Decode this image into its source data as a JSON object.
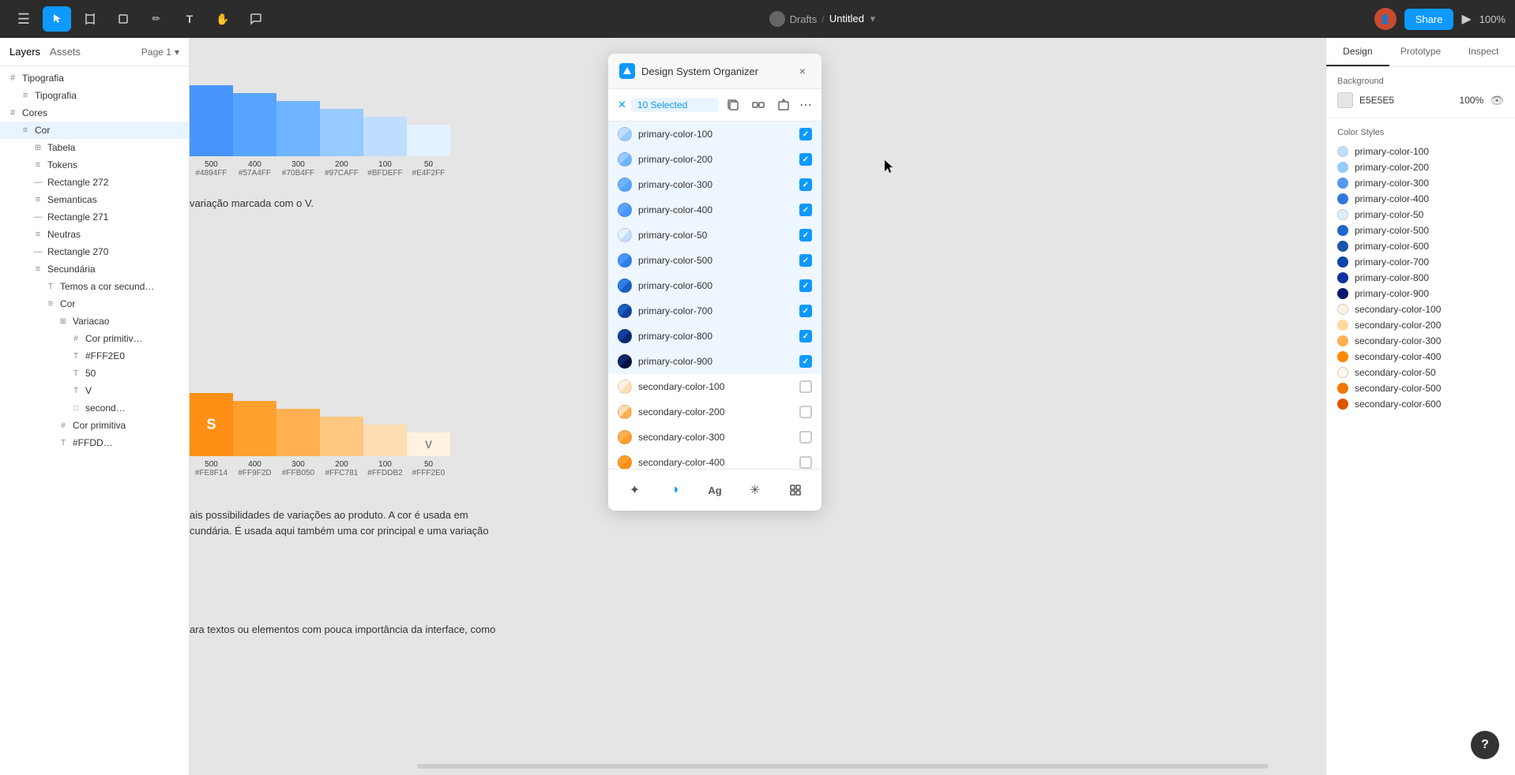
{
  "topbar": {
    "drafts_label": "Drafts",
    "separator": "/",
    "file_name": "Untitled",
    "share_label": "Share",
    "zoom_level": "100%",
    "tools": [
      {
        "name": "menu",
        "icon": "☰",
        "active": false
      },
      {
        "name": "move",
        "icon": "↖",
        "active": true
      },
      {
        "name": "frame",
        "icon": "⊞",
        "active": false
      },
      {
        "name": "shape",
        "icon": "□",
        "active": false
      },
      {
        "name": "pen",
        "icon": "✏",
        "active": false
      },
      {
        "name": "text",
        "icon": "T",
        "active": false
      },
      {
        "name": "hand",
        "icon": "✋",
        "active": false
      },
      {
        "name": "comment",
        "icon": "💬",
        "active": false
      }
    ]
  },
  "left_panel": {
    "tabs": [
      {
        "label": "Layers",
        "active": true
      },
      {
        "label": "Assets",
        "active": false
      }
    ],
    "page_selector": "Page 1",
    "layers": [
      {
        "id": "tipografia-group",
        "indent": 0,
        "icon": "#",
        "label": "Tipografia",
        "type": "group"
      },
      {
        "id": "tipografia-item",
        "indent": 1,
        "icon": "≡",
        "label": "Tipografia",
        "type": "item"
      },
      {
        "id": "cores-group",
        "indent": 0,
        "icon": "#",
        "label": "Cores",
        "type": "group"
      },
      {
        "id": "cor-item",
        "indent": 1,
        "icon": "≡",
        "label": "Cor",
        "type": "item",
        "selected": true
      },
      {
        "id": "tabela-item",
        "indent": 2,
        "icon": "⊞",
        "label": "Tabela",
        "type": "item"
      },
      {
        "id": "tokens-item",
        "indent": 2,
        "icon": "≡",
        "label": "Tokens",
        "type": "item"
      },
      {
        "id": "rect272-item",
        "indent": 2,
        "icon": "—",
        "label": "Rectangle 272",
        "type": "item"
      },
      {
        "id": "semanticas-item",
        "indent": 2,
        "icon": "≡",
        "label": "Semanticas",
        "type": "item"
      },
      {
        "id": "rect271-item",
        "indent": 2,
        "icon": "—",
        "label": "Rectangle 271",
        "type": "item"
      },
      {
        "id": "neutras-item",
        "indent": 2,
        "icon": "≡",
        "label": "Neutras",
        "type": "item"
      },
      {
        "id": "rect270-item",
        "indent": 2,
        "icon": "—",
        "label": "Rectangle 270",
        "type": "item"
      },
      {
        "id": "secundaria-item",
        "indent": 2,
        "icon": "≡",
        "label": "Secundária",
        "type": "item"
      },
      {
        "id": "temos-cor",
        "indent": 3,
        "icon": "T",
        "label": "Temos a cor secund…",
        "type": "item"
      },
      {
        "id": "cor2-item",
        "indent": 3,
        "icon": "≡",
        "label": "Cor",
        "type": "item"
      },
      {
        "id": "variacao-item",
        "indent": 4,
        "icon": "⊞",
        "label": "Variacao",
        "type": "item"
      },
      {
        "id": "cor-prim1",
        "indent": 5,
        "icon": "#",
        "label": "Cor primitiv…",
        "type": "item"
      },
      {
        "id": "fff2e0-item",
        "indent": 5,
        "icon": "T",
        "label": "#FFF2E0",
        "type": "item"
      },
      {
        "id": "50-item",
        "indent": 5,
        "icon": "T",
        "label": "50",
        "type": "item"
      },
      {
        "id": "v-item",
        "indent": 5,
        "icon": "T",
        "label": "V",
        "type": "item"
      },
      {
        "id": "second-item",
        "indent": 5,
        "icon": "□",
        "label": "second…",
        "type": "item"
      },
      {
        "id": "cor-prim2",
        "indent": 4,
        "icon": "#",
        "label": "Cor primitiva",
        "type": "item"
      },
      {
        "id": "ffdd-item",
        "indent": 4,
        "icon": "T",
        "label": "#FFDD…",
        "type": "item"
      }
    ]
  },
  "plugin": {
    "title": "Design System Organizer",
    "close_label": "×",
    "selected_count": "10 Selected",
    "items": [
      {
        "id": "pc100",
        "name": "primary-color-100",
        "color": "#BFDEFF",
        "checked": true
      },
      {
        "id": "pc200",
        "name": "primary-color-200",
        "color": "#97CAFF",
        "checked": true
      },
      {
        "id": "pc300",
        "name": "primary-color-300",
        "color": "#70B4FF",
        "checked": true
      },
      {
        "id": "pc400",
        "name": "primary-color-400",
        "color": "#57A4FF",
        "checked": true
      },
      {
        "id": "pc50",
        "name": "primary-color-50",
        "color": "#E4F2FF",
        "checked": true
      },
      {
        "id": "pc500",
        "name": "primary-color-500",
        "color": "#4894FF",
        "checked": true
      },
      {
        "id": "pc600",
        "name": "primary-color-600",
        "color": "#2d7fe8",
        "checked": true
      },
      {
        "id": "pc700",
        "name": "primary-color-700",
        "color": "#1a5fc0",
        "checked": true
      },
      {
        "id": "pc800",
        "name": "primary-color-800",
        "color": "#1040a0",
        "checked": true
      },
      {
        "id": "pc900",
        "name": "primary-color-900",
        "color": "#0a2870",
        "checked": true
      },
      {
        "id": "sc100",
        "name": "secondary-color-100",
        "color": "#FFF2E0",
        "checked": false
      },
      {
        "id": "sc200",
        "name": "secondary-color-200",
        "color": "#FFDDB2",
        "checked": false
      },
      {
        "id": "sc300",
        "name": "secondary-color-300",
        "color": "#FFB050",
        "checked": false
      },
      {
        "id": "sc400",
        "name": "secondary-color-400",
        "color": "#FF9F2D",
        "checked": false
      }
    ],
    "bottom_tools": [
      {
        "name": "styles",
        "icon": "✦"
      },
      {
        "name": "fill",
        "icon": "◑",
        "active": true
      },
      {
        "name": "text",
        "icon": "Ag"
      },
      {
        "name": "effects",
        "icon": "✳"
      },
      {
        "name": "grid",
        "icon": "⊞"
      }
    ]
  },
  "right_panel": {
    "tabs": [
      {
        "label": "Design",
        "active": true
      },
      {
        "label": "Prototype",
        "active": false
      },
      {
        "label": "Inspect",
        "active": false
      }
    ],
    "background": {
      "title": "Background",
      "color": "#E5E5E5",
      "hex": "E5E5E5",
      "opacity": "100%"
    },
    "color_styles": {
      "title": "Color Styles",
      "items": [
        {
          "label": "primary-color-100",
          "color": "#BFDEFF"
        },
        {
          "label": "primary-color-200",
          "color": "#97CAFF"
        },
        {
          "label": "primary-color-300",
          "color": "#5599ee"
        },
        {
          "label": "primary-color-400",
          "color": "#3377dd"
        },
        {
          "label": "primary-color-50",
          "color": "#ddeeff"
        },
        {
          "label": "primary-color-500",
          "color": "#2266cc"
        },
        {
          "label": "primary-color-600",
          "color": "#1a55aa"
        },
        {
          "label": "primary-color-700",
          "color": "#0d44aa"
        },
        {
          "label": "primary-color-800",
          "color": "#1030a0"
        },
        {
          "label": "primary-color-900",
          "color": "#081870"
        },
        {
          "label": "secondary-color-100",
          "color": "#FFF2E0"
        },
        {
          "label": "secondary-color-200",
          "color": "#FFD9A0"
        },
        {
          "label": "secondary-color-300",
          "color": "#FFB050"
        },
        {
          "label": "secondary-color-400",
          "color": "#FF8800"
        },
        {
          "label": "secondary-color-50",
          "color": "#FFF8EC"
        },
        {
          "label": "secondary-color-500",
          "color": "#EE7700"
        },
        {
          "label": "secondary-color-600",
          "color": "#DD5500"
        }
      ]
    }
  },
  "canvas": {
    "primary_colors": [
      {
        "label": "500",
        "hex": "#4894FF",
        "color": "#4894FF"
      },
      {
        "label": "400",
        "hex": "#57A4FF",
        "color": "#57A4FF"
      },
      {
        "label": "300",
        "hex": "#70B4FF",
        "color": "#70B4FF"
      },
      {
        "label": "200",
        "hex": "#97CAFF",
        "color": "#97CAFF"
      },
      {
        "label": "100",
        "hex": "#BFDEFF",
        "color": "#BFDEFF"
      },
      {
        "label": "50",
        "hex": "#E4F2FF",
        "color": "#E4F2FF"
      }
    ],
    "secondary_colors": [
      {
        "label": "500",
        "hex": "#FE8F14",
        "color": "#FE8F14"
      },
      {
        "label": "400",
        "hex": "#FF9F2D",
        "color": "#FF9F2D"
      },
      {
        "label": "300",
        "hex": "#FFB050",
        "color": "#FFB050"
      },
      {
        "label": "200",
        "hex": "#FFC781",
        "color": "#FFC781"
      },
      {
        "label": "100",
        "hex": "#FFDDB2",
        "color": "#FFDDB2"
      },
      {
        "label": "50",
        "hex": "#FFF2E0",
        "color": "#FFF2E0"
      }
    ],
    "text1": "variação marcada com o V.",
    "text2": "ais possibilidades de variações ao produto. A cor é usada em",
    "text3": "cundária. É usada aqui também uma cor principal e uma variação",
    "text4": "ara textos ou elementos com pouca importância da interface, como"
  }
}
